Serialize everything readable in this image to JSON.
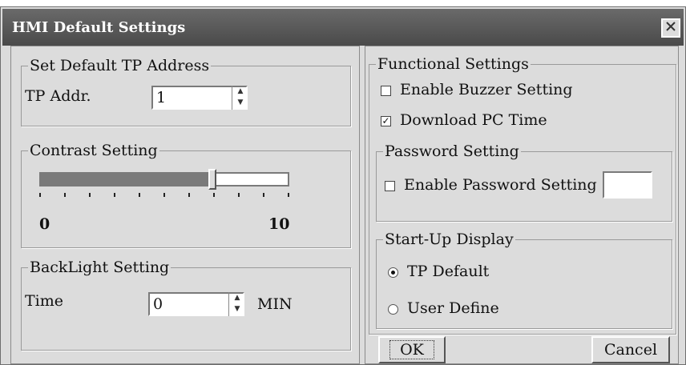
{
  "dialog": {
    "title": "HMI Default Settings"
  },
  "tp_address": {
    "group_title": "Set Default TP Address",
    "label": "TP Addr.",
    "value": "1"
  },
  "contrast": {
    "group_title": "Contrast Setting",
    "level": 0.7,
    "min_label": "0",
    "max_label": "10"
  },
  "backlight": {
    "group_title": "BackLight Setting",
    "label": "Time",
    "value": "0",
    "unit": "MIN"
  },
  "functional": {
    "group_title": "Functional Settings",
    "buzzer_label": "Enable Buzzer Setting",
    "buzzer_checked": false,
    "download_label": "Download PC Time",
    "download_checked": true
  },
  "password": {
    "group_title": "Password Setting",
    "enable_label": "Enable Password Setting",
    "enable_checked": false,
    "value": ""
  },
  "startup": {
    "group_title": "Start-Up Display",
    "options": [
      "TP Default",
      "User Define"
    ],
    "selected": 0
  },
  "buttons": {
    "ok": "OK",
    "cancel": "Cancel"
  },
  "icons": {
    "close": "close-icon"
  }
}
